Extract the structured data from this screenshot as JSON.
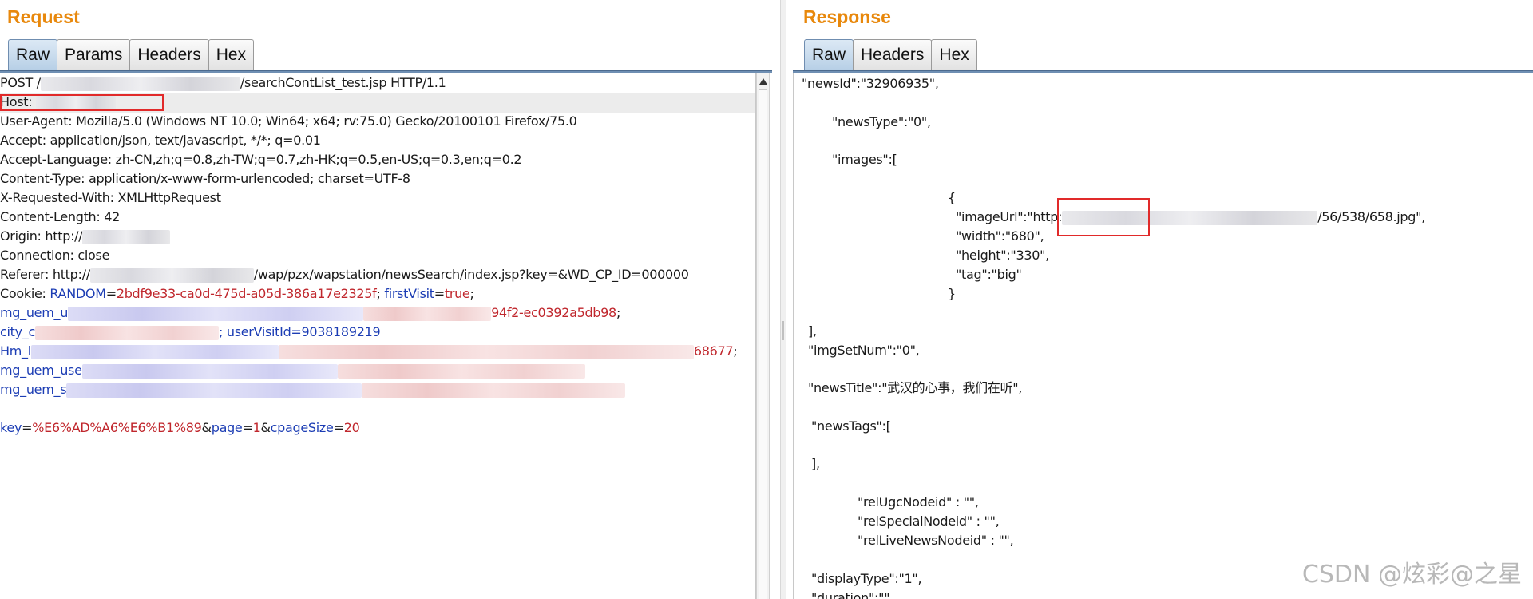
{
  "request": {
    "title": "Request",
    "tabs": [
      "Raw",
      "Params",
      "Headers",
      "Hex"
    ],
    "active_tab": "Raw",
    "lines": {
      "l1a": "POST /",
      "l1b": "/searchContList_test.jsp HTTP/1.1",
      "l2": "Host: ",
      "l3": "User-Agent: Mozilla/5.0 (Windows NT 10.0; Win64; x64; rv:75.0) Gecko/20100101 Firefox/75.0",
      "l4": "Accept: application/json, text/javascript, */*; q=0.01",
      "l5": "Accept-Language: zh-CN,zh;q=0.8,zh-TW;q=0.7,zh-HK;q=0.5,en-US;q=0.3,en;q=0.2",
      "l6": "Content-Type: application/x-www-form-urlencoded; charset=UTF-8",
      "l7": "X-Requested-With: XMLHttpRequest",
      "l8": "Content-Length: 42",
      "l9": "Origin: http://",
      "l10": "Connection: close",
      "l11a": "Referer: http://",
      "l11b": "/wap/pzx/wapstation/newsSearch/index.jsp?key=&WD_CP_ID=000000",
      "cookie_label": "Cookie: ",
      "cookie_k1": "RANDOM",
      "cookie_v1": "2bdf9e33-ca0d-475d-a05d-386a17e2325f",
      "cookie_k2": "firstVisit",
      "cookie_v2": "true",
      "c2_k": "mg_uem_u",
      "c2_v": "94f2-ec0392a5db98",
      "c3_k": "city_c",
      "c3_tail": "; userVisitId=9038189219",
      "c4_k": "Hm_l",
      "c4_v": "68677",
      "c5_k": "mg_uem_use",
      "c6_k": "mg_uem_s",
      "body_k1": "key",
      "body_v1": "%E6%AD%A6%E6%B1%89",
      "body_k2": "page",
      "body_v2": "1",
      "body_k3": "cpageSize",
      "body_v3": "20"
    }
  },
  "response": {
    "title": "Response",
    "tabs": [
      "Raw",
      "Headers",
      "Hex"
    ],
    "active_tab": "Raw",
    "lines": {
      "r1": "\"newsId\":\"32906935\",",
      "r2": "\"newsType\":\"0\",",
      "r3": "\"images\":[",
      "r4": "{",
      "r5a": "\"imageUrl\":\"http:",
      "r5b": "/56/538/658.jpg\",",
      "r6": "\"width\":\"680\",",
      "r7": "\"height\":\"330\",",
      "r8": "\"tag\":\"big\"",
      "r9": "}",
      "r10": "],",
      "r11": "\"imgSetNum\":\"0\",",
      "r12": "\"newsTitle\":\"武汉的心事，我们在听\",",
      "r13": "\"newsTags\":[",
      "r14": "],",
      "r15": "\"relUgcNodeid\" : \"\",",
      "r16": "\"relSpecialNodeid\" : \"\",",
      "r17": "\"relLiveNewsNodeid\" : \"\",",
      "r18": "\"displayType\":\"1\",",
      "r19": "\"duration\":\"\","
    }
  },
  "watermark": "CSDN @炫彩@之星",
  "colors": {
    "title_orange": "#e8880c",
    "key_blue": "#1c3db4",
    "value_red": "#c0272d",
    "highlight_box": "#e12a2a",
    "tab_active": "#b7cfe6"
  }
}
